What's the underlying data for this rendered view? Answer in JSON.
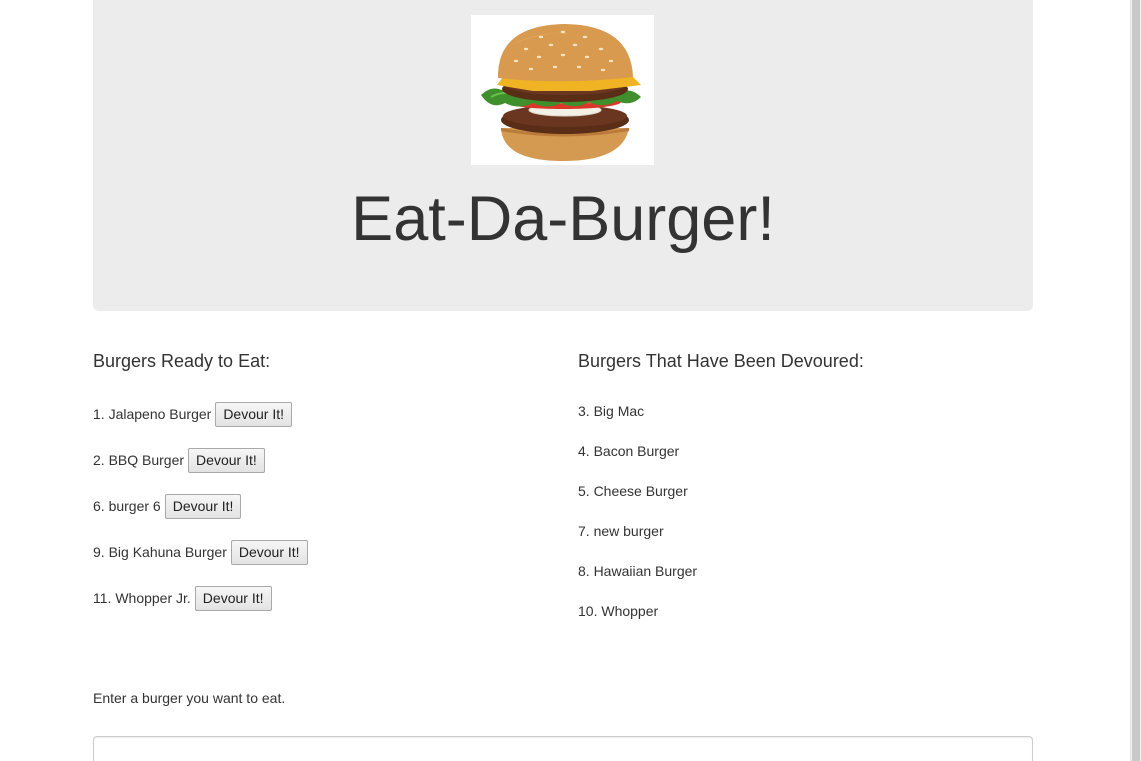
{
  "header": {
    "title": "Eat-Da-Burger!"
  },
  "ready": {
    "heading": "Burgers Ready to Eat:",
    "button_label": "Devour It!",
    "items": [
      {
        "label": "1. Jalapeno Burger"
      },
      {
        "label": "2. BBQ Burger"
      },
      {
        "label": "6. burger 6"
      },
      {
        "label": "9. Big Kahuna Burger"
      },
      {
        "label": "11. Whopper Jr."
      }
    ]
  },
  "devoured": {
    "heading": "Burgers That Have Been Devoured:",
    "items": [
      {
        "label": "3. Big Mac"
      },
      {
        "label": "4. Bacon Burger"
      },
      {
        "label": "5. Cheese Burger"
      },
      {
        "label": "7. new burger"
      },
      {
        "label": "8. Hawaiian Burger"
      },
      {
        "label": "10. Whopper"
      }
    ]
  },
  "form": {
    "label": "Enter a burger you want to eat.",
    "input_value": ""
  },
  "colors": {
    "jumbotron_bg": "#ececec",
    "text": "#333333",
    "page_bg": "#ffffff"
  }
}
